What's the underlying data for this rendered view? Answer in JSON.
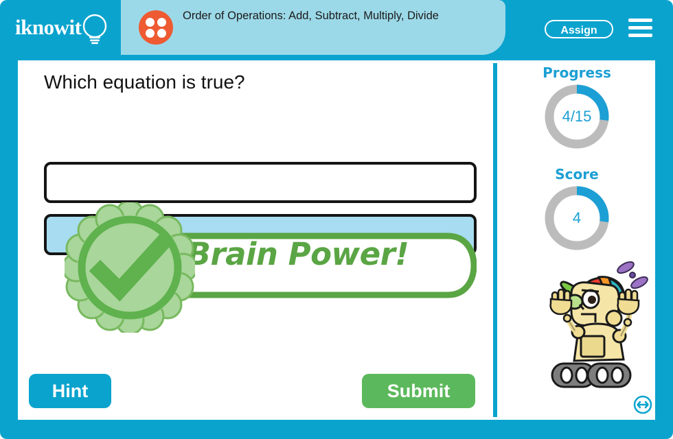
{
  "header": {
    "logo_text": "iknowit",
    "logo_icon": "lightbulb-icon",
    "lesson_icon": "four-dot-circle-icon",
    "lesson_title": "Order of Operations: Add, Subtract, Multiply, Divide",
    "assign_label": "Assign",
    "menu_icon": "hamburger-menu-icon"
  },
  "quiz": {
    "question": "Which equation is true?",
    "options": [
      {
        "label": "",
        "selected": false
      },
      {
        "label": "",
        "selected": true
      }
    ],
    "feedback": {
      "text": "Brain Power!",
      "badge_icon": "check-rosette-icon",
      "state": "correct"
    },
    "hint_label": "Hint",
    "submit_label": "Submit"
  },
  "sidebar": {
    "progress": {
      "title": "Progress",
      "value": "4/15",
      "current": 4,
      "total": 15,
      "percent": 27
    },
    "score": {
      "title": "Score",
      "value": "4",
      "current": 4,
      "percent": 27
    },
    "mascot_icon": "robot-mascot-icon",
    "resize_icon": "resize-horizontal-icon"
  },
  "colors": {
    "brand_blue": "#0aa3ce",
    "title_band": "#9cd9e8",
    "accent_orange": "#ee5a32",
    "ring_track": "#bcbcbc",
    "ring_fill": "#1c9fd4",
    "green": "#5cb85c",
    "feedback_green": "#5aa544",
    "option_selected": "#a8dcf0",
    "option_border": "#141414"
  }
}
